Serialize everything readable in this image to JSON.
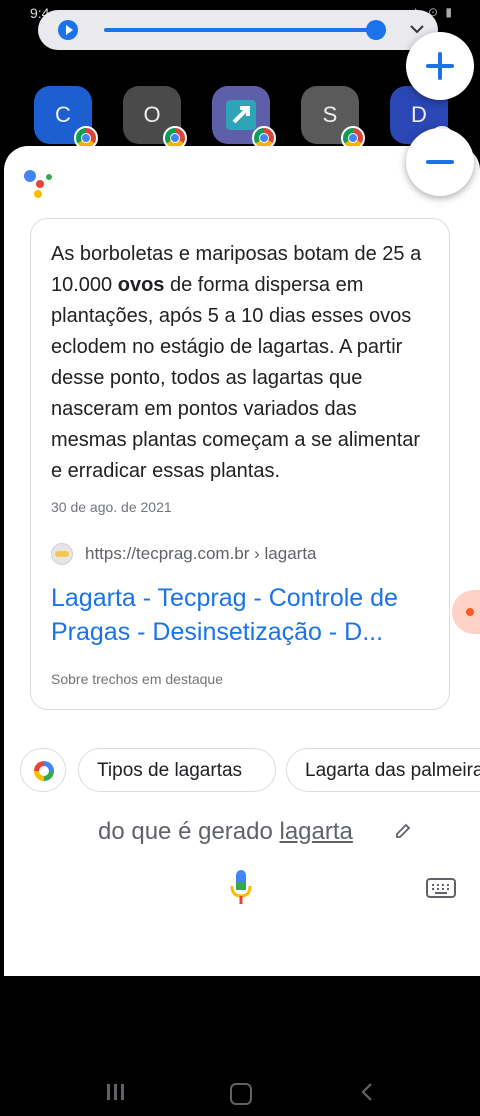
{
  "status_bar": {
    "time": "9:4",
    "right_icons": "✦ ⊙ ▮"
  },
  "media": {
    "progress": 0.92
  },
  "zoom": {
    "plus_label": "+",
    "minus_label": "−"
  },
  "apps": [
    {
      "letter": "C",
      "color": "#1c5fd0"
    },
    {
      "letter": "O",
      "color": "#4a4a4a"
    },
    {
      "letter": "",
      "color": "#5d5fa8"
    },
    {
      "letter": "S",
      "color": "#5a5a5a"
    },
    {
      "letter": "D",
      "color": "#2a47b5"
    }
  ],
  "card": {
    "snippet_before": "As borboletas e mariposas botam de 25 a 10.000 ",
    "snippet_bold": "ovos",
    "snippet_after": " de forma dispersa em plantações, após 5 a 10 dias esses ovos eclodem no estágio de lagartas. A partir desse ponto, todos as lagartas que nasceram em pontos variados das mesmas plantas começam a se alimentar e erradicar essas plantas.",
    "date": "30 de ago. de 2021",
    "source_url": "https://tecprag.com.br › lagarta",
    "result_title": "Lagarta - Tecprag - Controle de Pragas - Desinsetização - D...",
    "footer_note": "Sobre trechos em destaque"
  },
  "chips": {
    "chip1": "Tipos de lagartas",
    "chip2": "Lagarta das palmeiras"
  },
  "query": {
    "prefix": "do que é gerado ",
    "underlined": "lagarta"
  }
}
